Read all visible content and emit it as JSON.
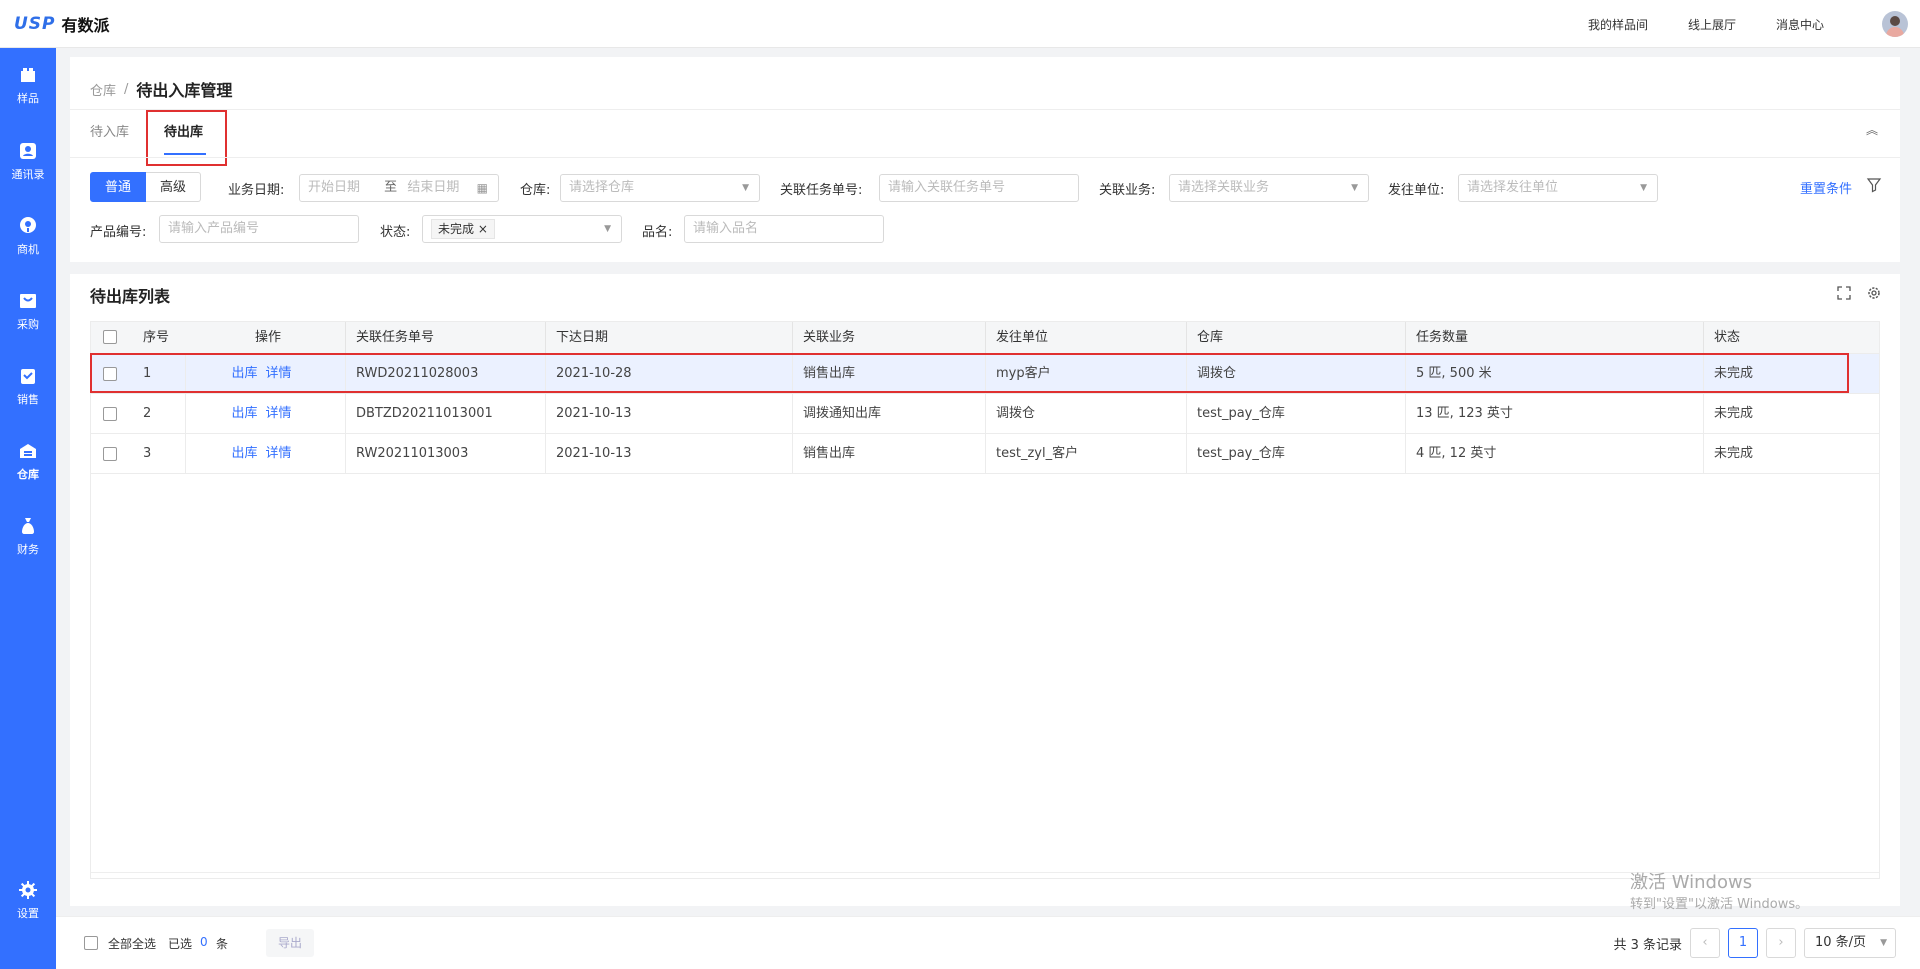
{
  "header": {
    "logo_mark": "USP",
    "logo_text": "有数派",
    "links": [
      "我的样品间",
      "线上展厅",
      "消息中心"
    ]
  },
  "sidebar": {
    "items": [
      {
        "label": "样品",
        "icon": "box-icon"
      },
      {
        "label": "通讯录",
        "icon": "contacts-icon"
      },
      {
        "label": "商机",
        "icon": "location-pin-icon"
      },
      {
        "label": "采购",
        "icon": "cart-icon"
      },
      {
        "label": "销售",
        "icon": "sales-icon"
      },
      {
        "label": "仓库",
        "icon": "warehouse-icon",
        "active": true
      },
      {
        "label": "财务",
        "icon": "moneybag-icon"
      }
    ],
    "settings_label": "设置"
  },
  "breadcrumb": {
    "parent": "仓库",
    "separator": "/",
    "current": "待出入库管理"
  },
  "tabs": [
    "待入库",
    "待出库"
  ],
  "filters": {
    "mode_normal": "普通",
    "mode_advanced": "高级",
    "date_label": "业务日期:",
    "date_start_placeholder": "开始日期",
    "date_to": "至",
    "date_end_placeholder": "结束日期",
    "warehouse_label": "仓库:",
    "warehouse_placeholder": "请选择仓库",
    "task_no_label": "关联任务单号:",
    "task_no_placeholder": "请输入关联任务单号",
    "biz_label": "关联业务:",
    "biz_placeholder": "请选择关联业务",
    "dest_label": "发往单位:",
    "dest_placeholder": "请选择发往单位",
    "reset_label": "重置条件",
    "product_no_label": "产品编号:",
    "product_no_placeholder": "请输入产品编号",
    "status_label": "状态:",
    "status_tag": "未完成",
    "name_label": "品名:",
    "name_placeholder": "请输入品名"
  },
  "list": {
    "title": "待出库列表",
    "columns": [
      "序号",
      "操作",
      "关联任务单号",
      "下达日期",
      "关联业务",
      "发往单位",
      "仓库",
      "任务数量",
      "状态"
    ],
    "action_out": "出库",
    "action_detail": "详情",
    "rows": [
      {
        "idx": "1",
        "task_no": "RWD20211028003",
        "date": "2021-10-28",
        "biz": "销售出库",
        "dest": "myp客户",
        "warehouse": "调拨仓",
        "qty": "5 匹, 500 米",
        "status": "未完成"
      },
      {
        "idx": "2",
        "task_no": "DBTZD20211013001",
        "date": "2021-10-13",
        "biz": "调拨通知出库",
        "dest": "调拨仓",
        "warehouse": "test_pay_仓库",
        "qty": "13 匹, 123 英寸",
        "status": "未完成"
      },
      {
        "idx": "3",
        "task_no": "RW20211013003",
        "date": "2021-10-13",
        "biz": "销售出库",
        "dest": "test_zyl_客户",
        "warehouse": "test_pay_仓库",
        "qty": "4 匹, 12 英寸",
        "status": "未完成"
      }
    ]
  },
  "footer": {
    "select_all": "全部全选",
    "selected_prefix": "已选",
    "selected_count": "0",
    "selected_suffix": "条",
    "export": "导出",
    "total": "共 3 条记录",
    "page": "1",
    "page_size": "10 条/页"
  },
  "watermark": {
    "line1": "激活 Windows",
    "line2": "转到\"设置\"以激活 Windows。"
  },
  "colors": {
    "primary": "#3370ff",
    "highlight_border": "#e03030"
  }
}
